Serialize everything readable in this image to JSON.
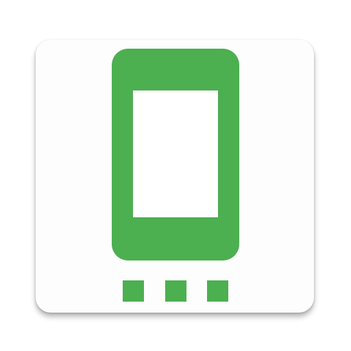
{
  "icon": {
    "semantic_name": "phone-device-icon",
    "tile_color": "#fdfdfd",
    "accent_color": "#4caf50",
    "screen_color": "#ffffff",
    "indicator_dots": 3
  }
}
